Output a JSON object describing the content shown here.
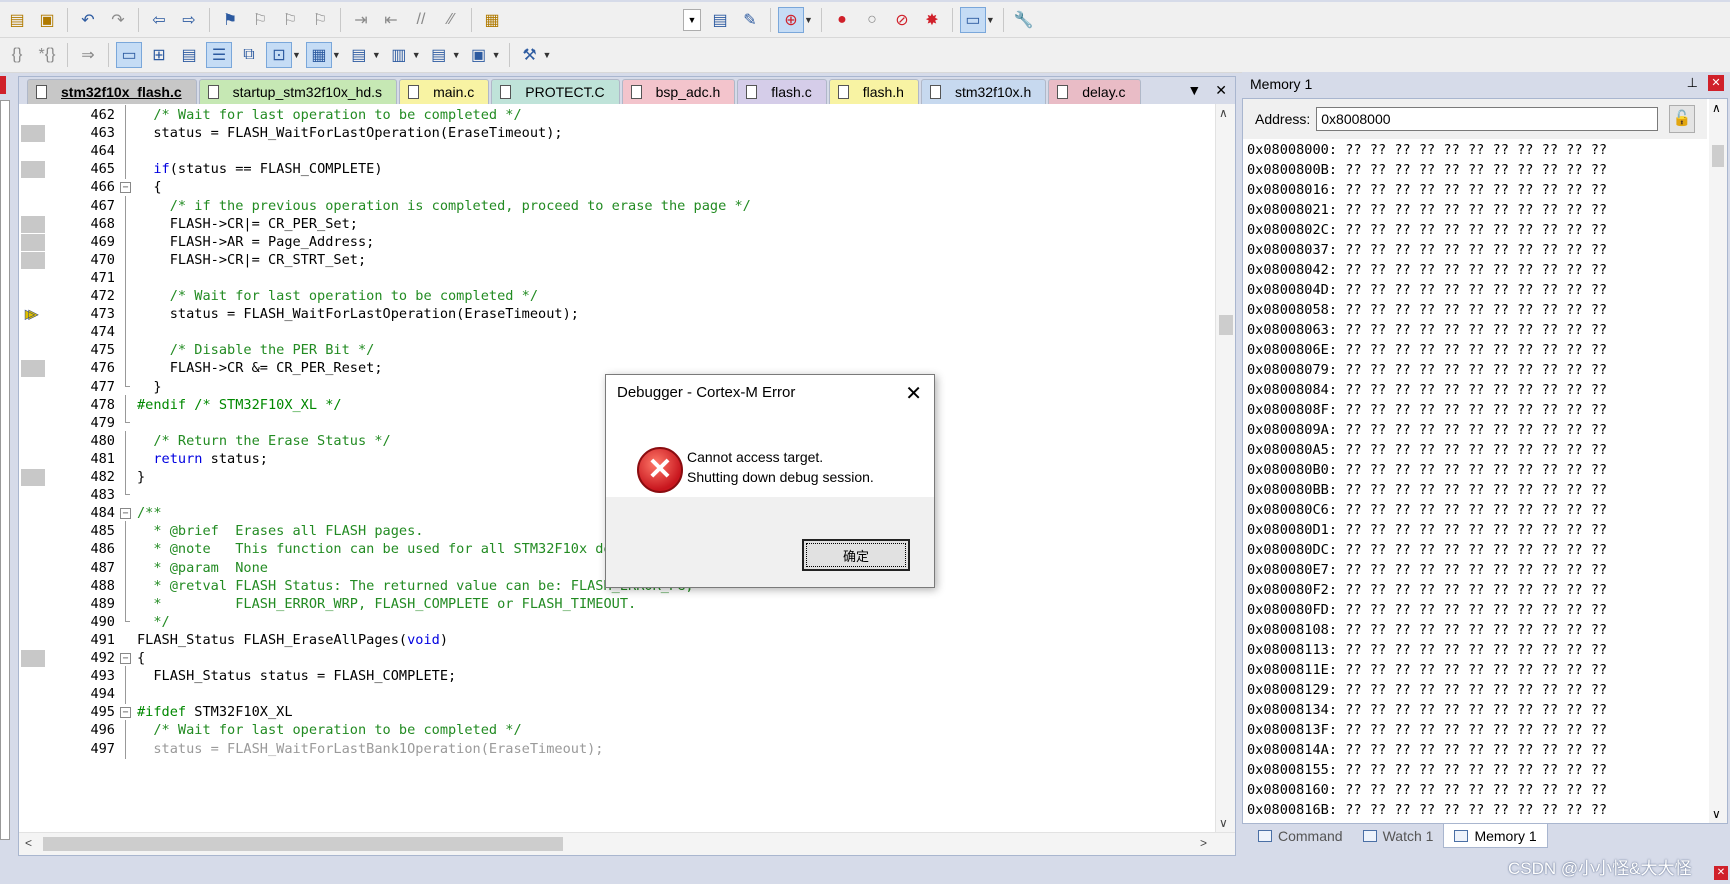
{
  "toolbar1": {
    "buttons": [
      "open-icon",
      "paste-icon",
      "undo-icon",
      "redo-icon",
      "nav-back-icon",
      "nav-forward-icon",
      "bookmark-icon",
      "bookmark-prev-icon",
      "bookmark-next-icon",
      "bookmark-clear-icon",
      "indent-icon",
      "unindent-icon",
      "comment-icon",
      "uncomment-icon",
      "find-in-files-icon",
      "find-combo",
      "find-icon",
      "incremental-find-icon",
      "debug-session-icon",
      "insert-breakpoint-icon",
      "enable-breakpoint-icon",
      "disable-breakpoints-icon",
      "kill-breakpoints-icon",
      "window-layout-icon",
      "configure-icon"
    ]
  },
  "toolbar2": {
    "buttons": [
      "command-window-icon",
      "disassembly-window-icon",
      "symbols-window-icon",
      "registers-window-icon",
      "call-stack-icon",
      "watch-windows-icon",
      "memory-windows-icon",
      "serial-windows-icon",
      "analysis-windows-icon",
      "trace-windows-icon",
      "system-viewer-icon",
      "toolbox-icon"
    ]
  },
  "editor": {
    "tabs": [
      {
        "label": "stm32f10x_flash.c",
        "color": "active"
      },
      {
        "label": "startup_stm32f10x_hd.s",
        "color": "green"
      },
      {
        "label": "main.c",
        "color": "yellow"
      },
      {
        "label": "PROTECT.C",
        "color": "teal"
      },
      {
        "label": "bsp_adc.h",
        "color": "pink"
      },
      {
        "label": "flash.c",
        "color": "lav"
      },
      {
        "label": "flash.h",
        "color": "yellow"
      },
      {
        "label": "stm32f10x.h",
        "color": "blue"
      },
      {
        "label": "delay.c",
        "color": "rose"
      }
    ],
    "lines": [
      {
        "n": "462",
        "t": "  /* Wait for last operation to be completed */",
        "s": "comment",
        "bp": false,
        "f": "line"
      },
      {
        "n": "463",
        "t": "  status = FLASH_WaitForLastOperation(EraseTimeout);",
        "s": "normal",
        "bp": true,
        "f": "line"
      },
      {
        "n": "464",
        "t": "",
        "s": "normal",
        "bp": false,
        "f": "line"
      },
      {
        "n": "465",
        "t": "  if(status == FLASH_COMPLETE)",
        "s": "if",
        "bp": true,
        "f": "line"
      },
      {
        "n": "466",
        "t": "  {",
        "s": "normal",
        "bp": false,
        "f": "open"
      },
      {
        "n": "467",
        "t": "    /* if the previous operation is completed, proceed to erase the page */",
        "s": "comment",
        "bp": false,
        "f": "line"
      },
      {
        "n": "468",
        "t": "    FLASH->CR|= CR_PER_Set;",
        "s": "normal",
        "bp": true,
        "f": "line"
      },
      {
        "n": "469",
        "t": "    FLASH->AR = Page_Address;",
        "s": "normal",
        "bp": true,
        "f": "line"
      },
      {
        "n": "470",
        "t": "    FLASH->CR|= CR_STRT_Set;",
        "s": "normal",
        "bp": true,
        "f": "line"
      },
      {
        "n": "471",
        "t": "",
        "s": "normal",
        "bp": false,
        "f": "line"
      },
      {
        "n": "472",
        "t": "    /* Wait for last operation to be completed */",
        "s": "comment",
        "bp": false,
        "f": "line"
      },
      {
        "n": "473",
        "t": "    status = FLASH_WaitForLastOperation(EraseTimeout);",
        "s": "normal",
        "bp": false,
        "f": "line",
        "arrow": true
      },
      {
        "n": "474",
        "t": "",
        "s": "normal",
        "bp": false,
        "f": "line"
      },
      {
        "n": "475",
        "t": "    /* Disable the PER Bit */",
        "s": "comment",
        "bp": false,
        "f": "line"
      },
      {
        "n": "476",
        "t": "    FLASH->CR &= CR_PER_Reset;",
        "s": "normal",
        "bp": true,
        "f": "line"
      },
      {
        "n": "477",
        "t": "  }",
        "s": "normal",
        "bp": false,
        "f": "end"
      },
      {
        "n": "478",
        "t": "#endif /* STM32F10X_XL */",
        "s": "pre",
        "bp": false,
        "f": "line"
      },
      {
        "n": "479",
        "t": "",
        "s": "normal",
        "bp": false,
        "f": "end"
      },
      {
        "n": "480",
        "t": "  /* Return the Erase Status */",
        "s": "comment",
        "bp": false,
        "f": "line"
      },
      {
        "n": "481",
        "t": "  return status;",
        "s": "return",
        "bp": false,
        "f": "line"
      },
      {
        "n": "482",
        "t": "}",
        "s": "normal",
        "bp": true,
        "f": "line"
      },
      {
        "n": "483",
        "t": "",
        "s": "normal",
        "bp": false,
        "f": "end"
      },
      {
        "n": "484",
        "t": "/**",
        "s": "comment",
        "bp": false,
        "f": "open"
      },
      {
        "n": "485",
        "t": "  * @brief  Erases all FLASH pages.",
        "s": "comment",
        "bp": false,
        "f": "line"
      },
      {
        "n": "486",
        "t": "  * @note   This function can be used for all STM32F10x devices.",
        "s": "comment",
        "bp": false,
        "f": "line"
      },
      {
        "n": "487",
        "t": "  * @param  None",
        "s": "comment",
        "bp": false,
        "f": "line"
      },
      {
        "n": "488",
        "t": "  * @retval FLASH Status: The returned value can be: FLASH_ERROR_PG,",
        "s": "comment",
        "bp": false,
        "f": "line"
      },
      {
        "n": "489",
        "t": "  *         FLASH_ERROR_WRP, FLASH_COMPLETE or FLASH_TIMEOUT.",
        "s": "comment",
        "bp": false,
        "f": "line"
      },
      {
        "n": "490",
        "t": "  */",
        "s": "comment",
        "bp": false,
        "f": "end"
      },
      {
        "n": "491",
        "t": "FLASH_Status FLASH_EraseAllPages(void)",
        "s": "void",
        "bp": false,
        "f": "none"
      },
      {
        "n": "492",
        "t": "{",
        "s": "normal",
        "bp": true,
        "f": "open"
      },
      {
        "n": "493",
        "t": "  FLASH_Status status = FLASH_COMPLETE;",
        "s": "normal",
        "bp": false,
        "f": "line"
      },
      {
        "n": "494",
        "t": "",
        "s": "normal",
        "bp": false,
        "f": "line"
      },
      {
        "n": "495",
        "t": "#ifdef STM32F10X_XL",
        "s": "ifdef",
        "bp": false,
        "f": "open"
      },
      {
        "n": "496",
        "t": "  /* Wait for last operation to be completed */",
        "s": "comment",
        "bp": false,
        "f": "line"
      },
      {
        "n": "497",
        "t": "  status = FLASH_WaitForLastBank1Operation(EraseTimeout);",
        "s": "faded",
        "bp": false,
        "f": "line"
      }
    ]
  },
  "memory": {
    "title": "Memory 1",
    "address_label": "Address:",
    "address_value": "0x8008000",
    "rows": [
      "0x08008000: ?? ?? ?? ?? ?? ?? ?? ?? ?? ?? ??",
      "0x0800800B: ?? ?? ?? ?? ?? ?? ?? ?? ?? ?? ??",
      "0x08008016: ?? ?? ?? ?? ?? ?? ?? ?? ?? ?? ??",
      "0x08008021: ?? ?? ?? ?? ?? ?? ?? ?? ?? ?? ??",
      "0x0800802C: ?? ?? ?? ?? ?? ?? ?? ?? ?? ?? ??",
      "0x08008037: ?? ?? ?? ?? ?? ?? ?? ?? ?? ?? ??",
      "0x08008042: ?? ?? ?? ?? ?? ?? ?? ?? ?? ?? ??",
      "0x0800804D: ?? ?? ?? ?? ?? ?? ?? ?? ?? ?? ??",
      "0x08008058: ?? ?? ?? ?? ?? ?? ?? ?? ?? ?? ??",
      "0x08008063: ?? ?? ?? ?? ?? ?? ?? ?? ?? ?? ??",
      "0x0800806E: ?? ?? ?? ?? ?? ?? ?? ?? ?? ?? ??",
      "0x08008079: ?? ?? ?? ?? ?? ?? ?? ?? ?? ?? ??",
      "0x08008084: ?? ?? ?? ?? ?? ?? ?? ?? ?? ?? ??",
      "0x0800808F: ?? ?? ?? ?? ?? ?? ?? ?? ?? ?? ??",
      "0x0800809A: ?? ?? ?? ?? ?? ?? ?? ?? ?? ?? ??",
      "0x080080A5: ?? ?? ?? ?? ?? ?? ?? ?? ?? ?? ??",
      "0x080080B0: ?? ?? ?? ?? ?? ?? ?? ?? ?? ?? ??",
      "0x080080BB: ?? ?? ?? ?? ?? ?? ?? ?? ?? ?? ??",
      "0x080080C6: ?? ?? ?? ?? ?? ?? ?? ?? ?? ?? ??",
      "0x080080D1: ?? ?? ?? ?? ?? ?? ?? ?? ?? ?? ??",
      "0x080080DC: ?? ?? ?? ?? ?? ?? ?? ?? ?? ?? ??",
      "0x080080E7: ?? ?? ?? ?? ?? ?? ?? ?? ?? ?? ??",
      "0x080080F2: ?? ?? ?? ?? ?? ?? ?? ?? ?? ?? ??",
      "0x080080FD: ?? ?? ?? ?? ?? ?? ?? ?? ?? ?? ??",
      "0x08008108: ?? ?? ?? ?? ?? ?? ?? ?? ?? ?? ??",
      "0x08008113: ?? ?? ?? ?? ?? ?? ?? ?? ?? ?? ??",
      "0x0800811E: ?? ?? ?? ?? ?? ?? ?? ?? ?? ?? ??",
      "0x08008129: ?? ?? ?? ?? ?? ?? ?? ?? ?? ?? ??",
      "0x08008134: ?? ?? ?? ?? ?? ?? ?? ?? ?? ?? ??",
      "0x0800813F: ?? ?? ?? ?? ?? ?? ?? ?? ?? ?? ??",
      "0x0800814A: ?? ?? ?? ?? ?? ?? ?? ?? ?? ?? ??",
      "0x08008155: ?? ?? ?? ?? ?? ?? ?? ?? ?? ?? ??",
      "0x08008160: ?? ?? ?? ?? ?? ?? ?? ?? ?? ?? ??",
      "0x0800816B: ?? ?? ?? ?? ?? ?? ?? ?? ?? ?? ??"
    ],
    "bottom_tabs": [
      "Command",
      "Watch 1",
      "Memory 1"
    ],
    "active_tab": "Memory 1"
  },
  "dialog": {
    "title": "Debugger - Cortex-M Error",
    "message_line1": "Cannot access target.",
    "message_line2": "Shutting down debug session.",
    "ok_label": "确定",
    "icon": "error-icon"
  },
  "watermark": "CSDN @小小怪&大大怪",
  "colors": {
    "comment": "#228b22",
    "keyword": "#0000e0",
    "preprocessor": "#008800",
    "panel_bg": "#d6dbe9",
    "error_red": "#d0202a"
  }
}
